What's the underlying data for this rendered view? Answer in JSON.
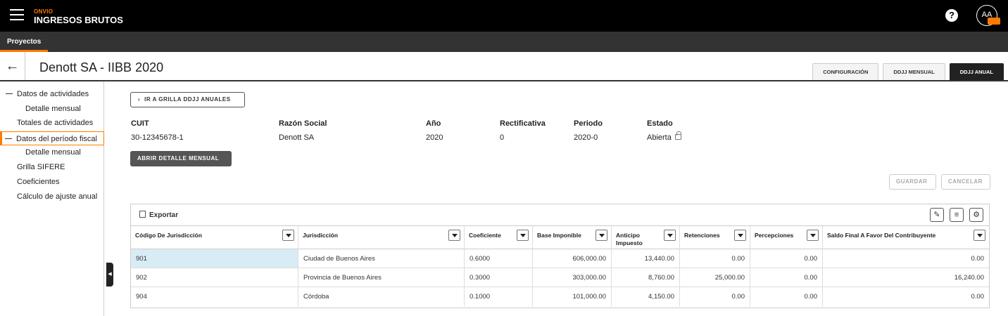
{
  "topbar": {
    "brand_small": "ONVIO",
    "brand_big": "INGRESOS BRUTOS",
    "help_icon": "?",
    "avatar_initials": "AA",
    "avatar_badge": ""
  },
  "navbar": {
    "tab": "Proyectos"
  },
  "header": {
    "back_icon": "←",
    "title": "Denott SA - IIBB 2020",
    "tabs": [
      "CONFIGURACIÓN",
      "DDJJ MENSUAL",
      "DDJJ ANUAL"
    ]
  },
  "sidebar": {
    "items": [
      "Datos de actividades",
      "Detalle mensual",
      "Totales de actividades",
      "Datos del período fiscal",
      "Detalle mensual",
      "Grilla SIFERE",
      "Coeficientes",
      "Cálculo de ajuste anual"
    ]
  },
  "main": {
    "back_grid_button": "IR A GRILLA DDJJ ANUALES",
    "info_labels": [
      "CUIT",
      "Razón Social",
      "Año",
      "Rectificativa",
      "Periodo",
      "Estado"
    ],
    "info_values": [
      "30-12345678-1",
      "Denott SA",
      "2020",
      "0",
      "2020-0",
      "Abierta"
    ],
    "open_detail_button": "ABRIR DETALLE MENSUAL",
    "save_button": "GUARDAR",
    "cancel_button": "CANCELAR"
  },
  "grid": {
    "export_label": "Exportar",
    "columns": [
      "Código De Jurisdicción",
      "Jurisdicción",
      "Coeficiente",
      "Base Imponible",
      "Anticipo Impuesto",
      "Retenciones",
      "Percepciones",
      "Saldo Final A Favor Del Contribuyente"
    ],
    "rows": [
      [
        "901",
        "Ciudad de Buenos Aires",
        "0.6000",
        "606,000.00",
        "13,440.00",
        "0.00",
        "0.00",
        "0.00"
      ],
      [
        "902",
        "Provincia de Buenos Aires",
        "0.3000",
        "303,000.00",
        "8,760.00",
        "25,000.00",
        "0.00",
        "16,240.00"
      ],
      [
        "904",
        "Córdoba",
        "0.1000",
        "101,000.00",
        "4,150.00",
        "0.00",
        "0.00",
        "0.00"
      ]
    ]
  }
}
